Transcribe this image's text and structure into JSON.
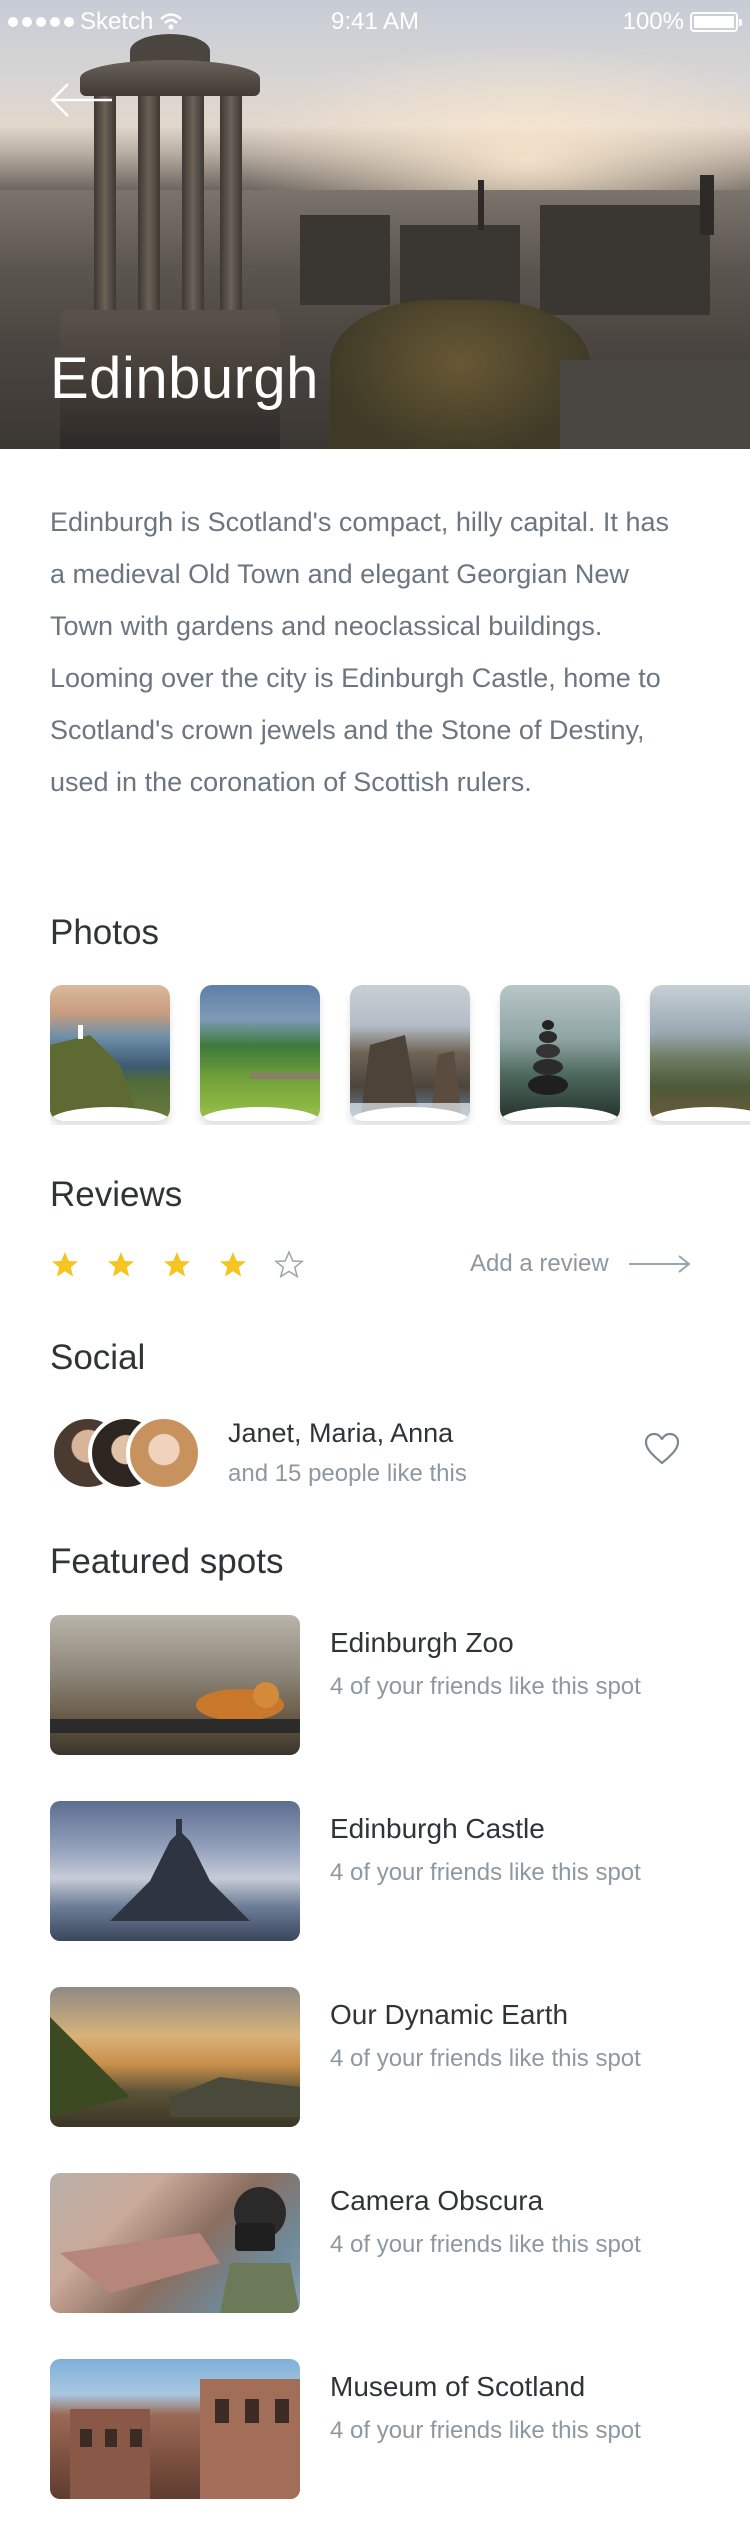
{
  "status_bar": {
    "carrier": "Sketch",
    "time": "9:41 AM",
    "battery": "100%"
  },
  "hero": {
    "title": "Edinburgh",
    "back_icon": "arrow-left-icon"
  },
  "description": "Edinburgh is Scotland's compact, hilly capital. It has a medieval Old Town and elegant Georgian New Town with gardens and neoclassical buildings. Looming over the city is Edinburgh Castle, home to Scotland's crown jewels and the Stone of Destiny, used in the coronation of Scottish rulers.",
  "photos": {
    "title": "Photos",
    "items": [
      {
        "subject": "coastal-cliff-lighthouse"
      },
      {
        "subject": "green-valley-viaduct"
      },
      {
        "subject": "sea-stacks-cliff"
      },
      {
        "subject": "stacked-stones-lake"
      },
      {
        "subject": "mountain-lake"
      }
    ]
  },
  "reviews": {
    "title": "Reviews",
    "rating": 4,
    "max_rating": 5,
    "add_review": "Add a review"
  },
  "social": {
    "title": "Social",
    "names": "Janet, Maria, Anna",
    "sub": "and 15 people like this"
  },
  "featured": {
    "title": "Featured spots",
    "items": [
      {
        "name": "Edinburgh Zoo",
        "sub": "4 of your friends like this spot"
      },
      {
        "name": "Edinburgh Castle",
        "sub": "4 of your friends like this spot"
      },
      {
        "name": "Our Dynamic Earth",
        "sub": "4 of your friends like this spot"
      },
      {
        "name": "Camera Obscura",
        "sub": "4 of your friends like this spot"
      },
      {
        "name": "Museum of Scotland",
        "sub": "4 of your friends like this spot"
      }
    ]
  },
  "colors": {
    "star": "#f6c521",
    "star_empty": "#9aa4ad",
    "text_dark": "#2f3437",
    "text_muted": "#8e98a0"
  }
}
